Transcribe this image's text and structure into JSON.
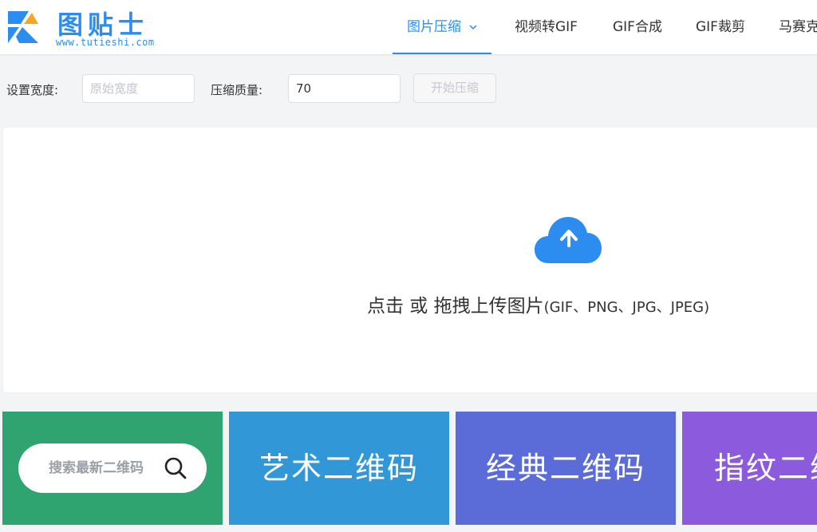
{
  "brand": {
    "name": "图贴士",
    "url": "www.tutieshi.com",
    "color": "#2d8cf0"
  },
  "nav": {
    "items": [
      {
        "label": "图片压缩",
        "icon": "chevron-down-icon",
        "active": true
      },
      {
        "label": "视频转GIF"
      },
      {
        "label": "GIF合成"
      },
      {
        "label": "GIF裁剪"
      },
      {
        "label": "马赛克"
      }
    ]
  },
  "settings": {
    "width_label": "设置宽度:",
    "width_placeholder": "原始宽度",
    "quality_label": "压缩质量:",
    "quality_value": "70",
    "start_button": "开始压缩"
  },
  "upload": {
    "icon": "cloud-upload-icon",
    "main_text": "点击 或 拖拽上传图片",
    "formats_text": "(GIF、PNG、JPG、JPEG)"
  },
  "tiles": [
    {
      "search_placeholder": "搜索最新二维码",
      "icon": "search-icon",
      "color": "#2fa471"
    },
    {
      "label": "艺术二维码",
      "color": "#3197d6"
    },
    {
      "label": "经典二维码",
      "color": "#5b6cd9"
    },
    {
      "label": "指纹二维码",
      "color": "#8c5add"
    }
  ]
}
